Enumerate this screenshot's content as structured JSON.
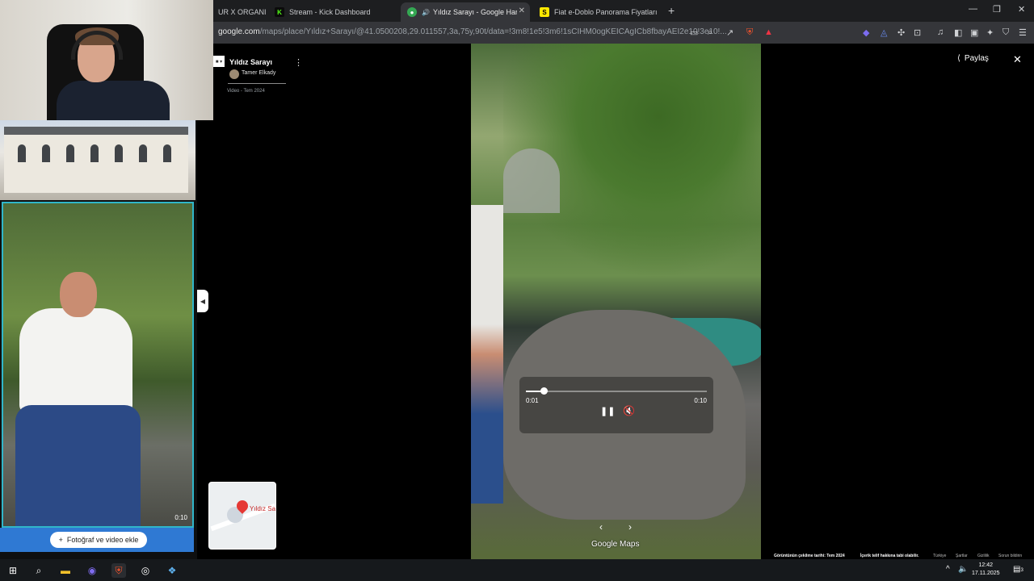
{
  "browser": {
    "tabs": [
      {
        "label": "UR X ORGANI",
        "icon": "tab-favicon"
      },
      {
        "label": "Stream - Kick Dashboard",
        "icon": "kick-icon",
        "icon_color": "#53fc18"
      },
      {
        "label": "Yıldız Sarayı - Google Haritalar",
        "icon": "maps-icon",
        "audio": "🔊"
      },
      {
        "label": "Fiat e-Doblo Panorama Fiyatları & M",
        "icon": "sahibinden-icon",
        "icon_color": "#ffe800"
      }
    ],
    "new_tab": "+",
    "url_main": "google.com",
    "url_rest": "/maps/place/Yıldız+Sarayı/@41.0500208,29.011557,3a,75y,90t/data=!3m8!1e5!3m6!1sCIHM0ogKEICAgICb8fbayAEI2e10!3e10!..."
  },
  "place": {
    "name": "Yıldız Sarayı",
    "author": "Tamer Elkady",
    "date": "Video - Tem 2024",
    "menu": "⋮"
  },
  "left": {
    "thumb_duration": "0:10",
    "add_photo": "Fotoğraf ve video ekle",
    "add_icon": "+"
  },
  "minimap": {
    "label": "Yıldız Sar"
  },
  "video": {
    "current": "0:01",
    "duration": "0:10",
    "progress": 0.1,
    "pause": "❚❚",
    "mute": "🔇",
    "prev": "‹",
    "next": "›",
    "logo": "Google Maps"
  },
  "share_label": "Paylaş",
  "close": "✕",
  "footer": {
    "captured": "Görüntünün çekilme tarihi: Tem 2024",
    "copyright": "İçerik telif hakkına tabi olabilir.",
    "country": "Türkiye",
    "terms": "Şartlar",
    "privacy": "Gizlilik",
    "report": "Sorun bildirin"
  },
  "taskbar": {
    "time": "12:42",
    "date": "17.11.2025",
    "notif_count": "3"
  }
}
